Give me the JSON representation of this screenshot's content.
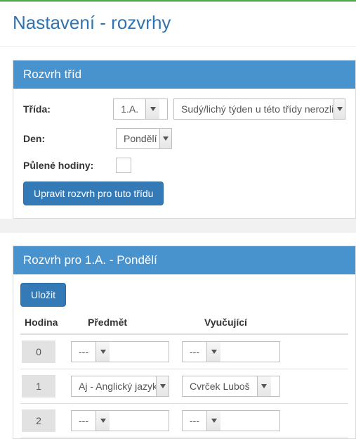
{
  "page_title": "Nastavení - rozvrhy",
  "panel1": {
    "title": "Rozvrh tříd",
    "labels": {
      "trida": "Třída:",
      "den": "Den:",
      "pulene": "Půlené hodiny:"
    },
    "selects": {
      "trida": "1.A.",
      "week": "Sudý/lichý týden u této třídy nerozlišujeme",
      "den": "Pondělí"
    },
    "button": "Upravit rozvrh pro tuto třídu"
  },
  "panel2": {
    "title": "Rozvrh pro 1.A. - Pondělí",
    "save": "Uložit",
    "headers": {
      "hodina": "Hodina",
      "predmet": "Předmět",
      "vyucujici": "Vyučující"
    },
    "rows": [
      {
        "hour": "0",
        "subject": "---",
        "teacher": "---"
      },
      {
        "hour": "1",
        "subject": "Aj - Anglický jazyk",
        "teacher": "Cvrček Luboš"
      },
      {
        "hour": "2",
        "subject": "---",
        "teacher": "---"
      }
    ]
  }
}
